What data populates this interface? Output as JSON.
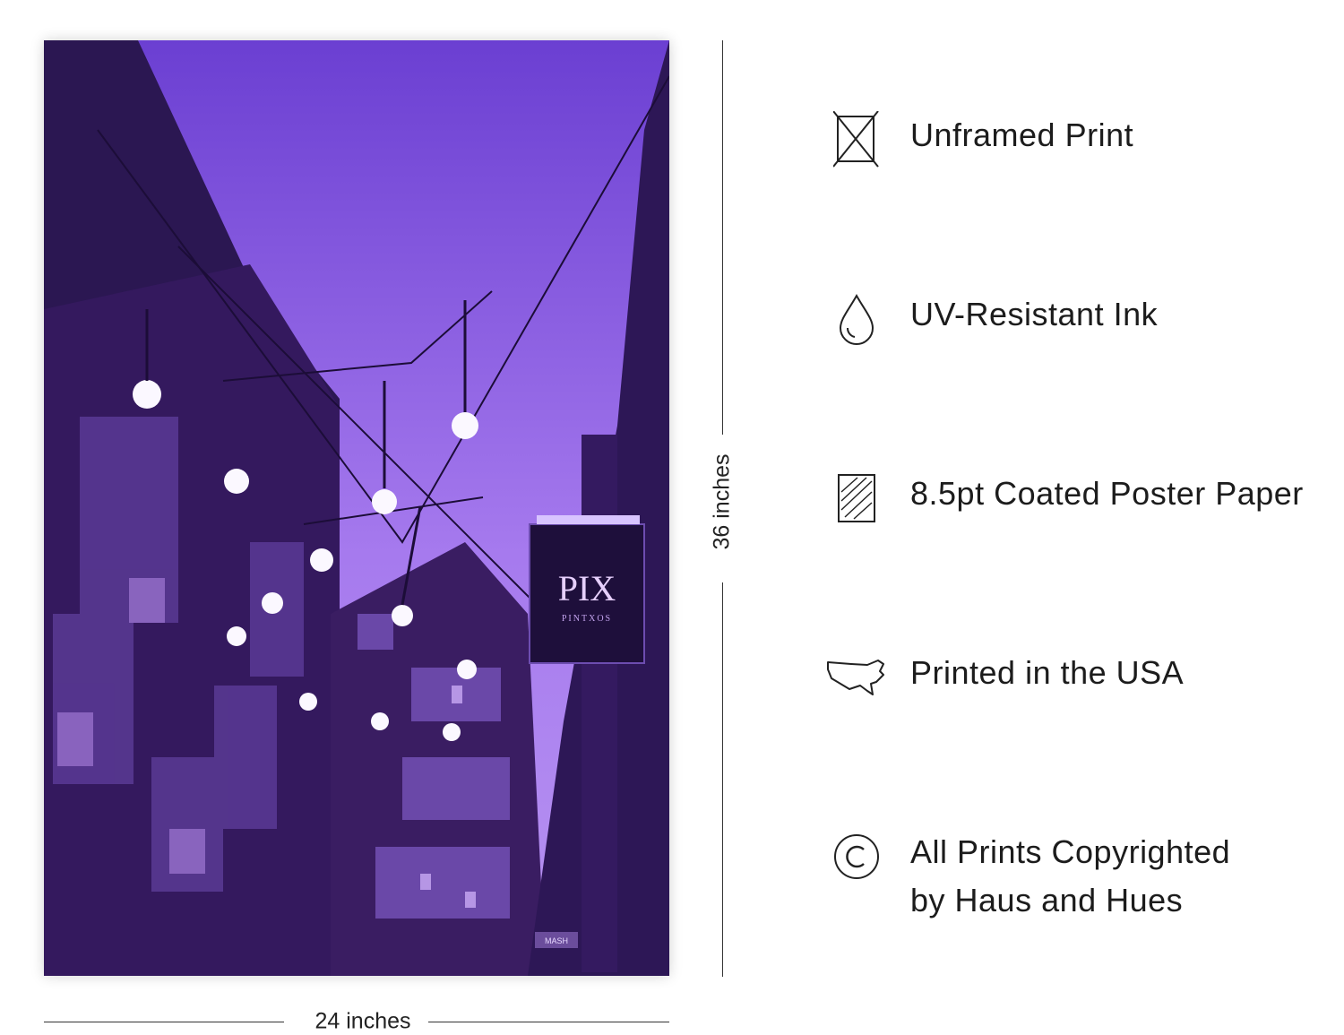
{
  "poster": {
    "sign_title": "PIX",
    "sign_subtitle": "PINTXOS",
    "corner_sign": "MASH"
  },
  "dimensions": {
    "height_label": "36 inches",
    "width_label": "24 inches"
  },
  "features": [
    {
      "icon": "unframed-print-icon",
      "label": "Unframed Print"
    },
    {
      "icon": "ink-drop-icon",
      "label": "UV-Resistant Ink"
    },
    {
      "icon": "poster-paper-icon",
      "label": "8.5pt Coated Poster Paper"
    },
    {
      "icon": "usa-map-icon",
      "label": "Printed in the USA"
    },
    {
      "icon": "copyright-icon",
      "label_line1": "All Prints Copyrighted",
      "label_line2": "by Haus and Hues"
    }
  ],
  "colors": {
    "sky_top": "#6a3fd0",
    "sky_bottom": "#b48af0",
    "building_dark": "#2a1650",
    "window_glow": "#c9a0f5",
    "bulb": "#fbf8ff"
  }
}
